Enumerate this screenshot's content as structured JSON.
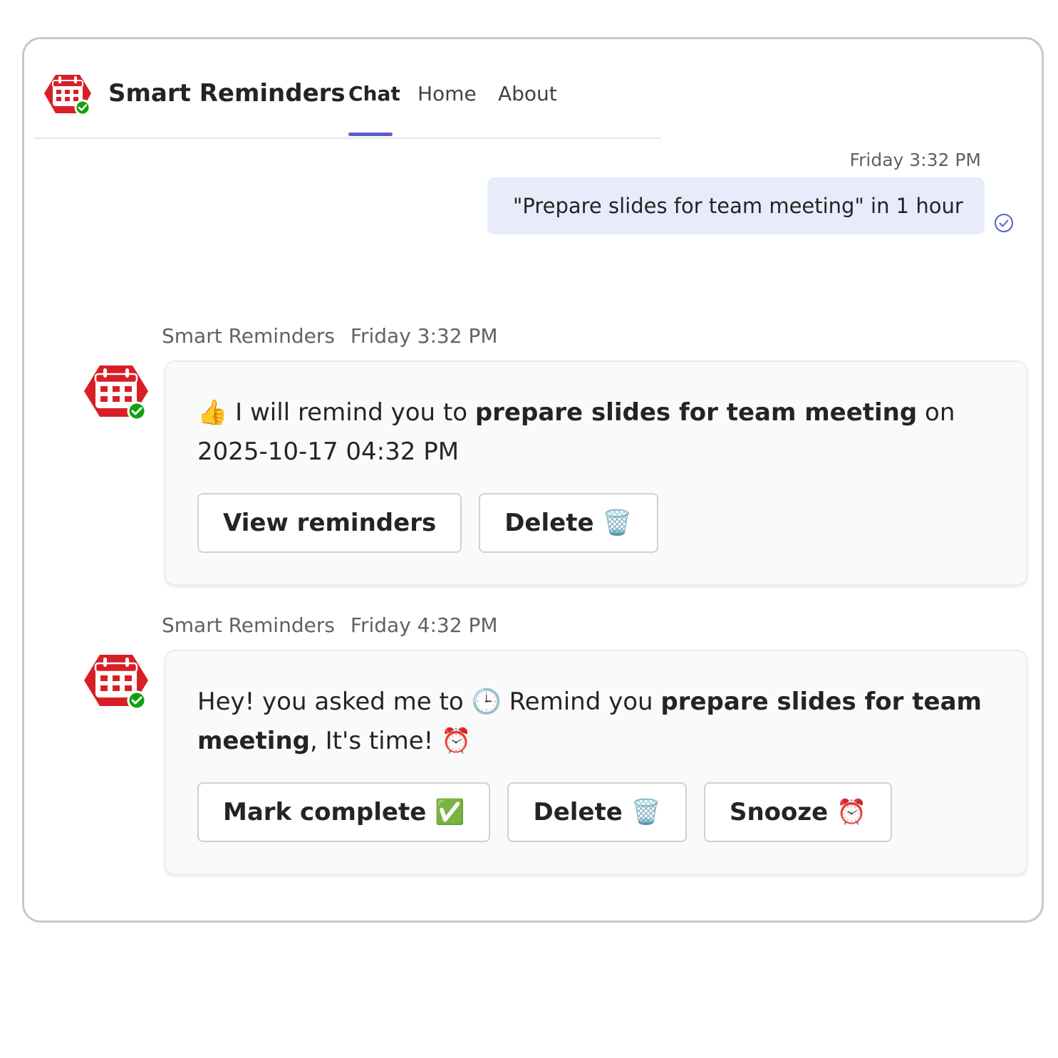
{
  "app": {
    "title": "Smart Reminders",
    "tabs": [
      {
        "label": "Chat",
        "active": true
      },
      {
        "label": "Home",
        "active": false
      },
      {
        "label": "About",
        "active": false
      }
    ]
  },
  "colors": {
    "accent": "#5b5fc7",
    "user_bubble": "#e8ebfa",
    "logo_red": "#d81f26",
    "presence_green": "#13a10e"
  },
  "user_message": {
    "time": "Friday 3:32 PM",
    "text": "\"Prepare slides for team meeting\" in 1 hour",
    "status_icon": "read-receipt-check-icon"
  },
  "bot_messages": [
    {
      "sender": "Smart Reminders",
      "time": "Friday 3:32 PM",
      "parts": {
        "emoji": "👍",
        "pre": " I will remind you to ",
        "bold": "prepare slides for team meeting",
        "post": " on 2025-10-17 04:32 PM"
      },
      "buttons": [
        "View reminders",
        "Delete 🗑️"
      ]
    },
    {
      "sender": "Smart Reminders",
      "time": "Friday 4:32 PM",
      "parts": {
        "pre": "Hey! you asked me to 🕒 Remind you ",
        "bold": "prepare slides for team meeting",
        "post": ", It's time! ⏰"
      },
      "buttons": [
        "Mark complete ✅",
        "Delete 🗑️",
        "Snooze ⏰"
      ]
    }
  ]
}
